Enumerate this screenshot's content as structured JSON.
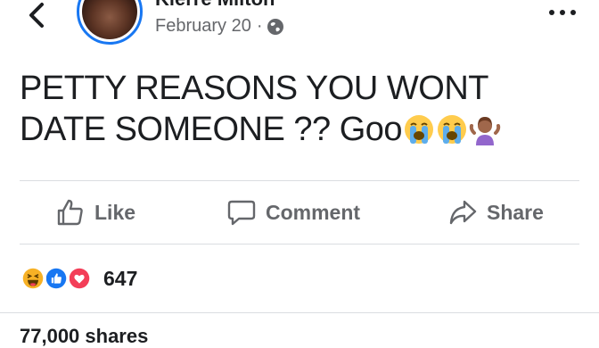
{
  "post": {
    "author_name": "Kierre Milton",
    "date": "February 20",
    "separator": "·",
    "privacy_icon": "globe-icon",
    "text_line1": "PETTY REASONS YOU WONT",
    "text_line2": "DATE SOMEONE ?? Goo",
    "emojis": [
      "loudly-crying-face",
      "loudly-crying-face",
      "woman-shrugging"
    ]
  },
  "actions": {
    "like_label": "Like",
    "comment_label": "Comment",
    "share_label": "Share"
  },
  "reactions": {
    "types": [
      "haha",
      "like",
      "love"
    ],
    "count": "647"
  },
  "shares": {
    "text": "77,000 shares"
  },
  "colors": {
    "accent": "#1877f2",
    "love": "#f33e58",
    "haha": "#f7b125",
    "muted": "#65676b",
    "divider": "#dadde1"
  }
}
